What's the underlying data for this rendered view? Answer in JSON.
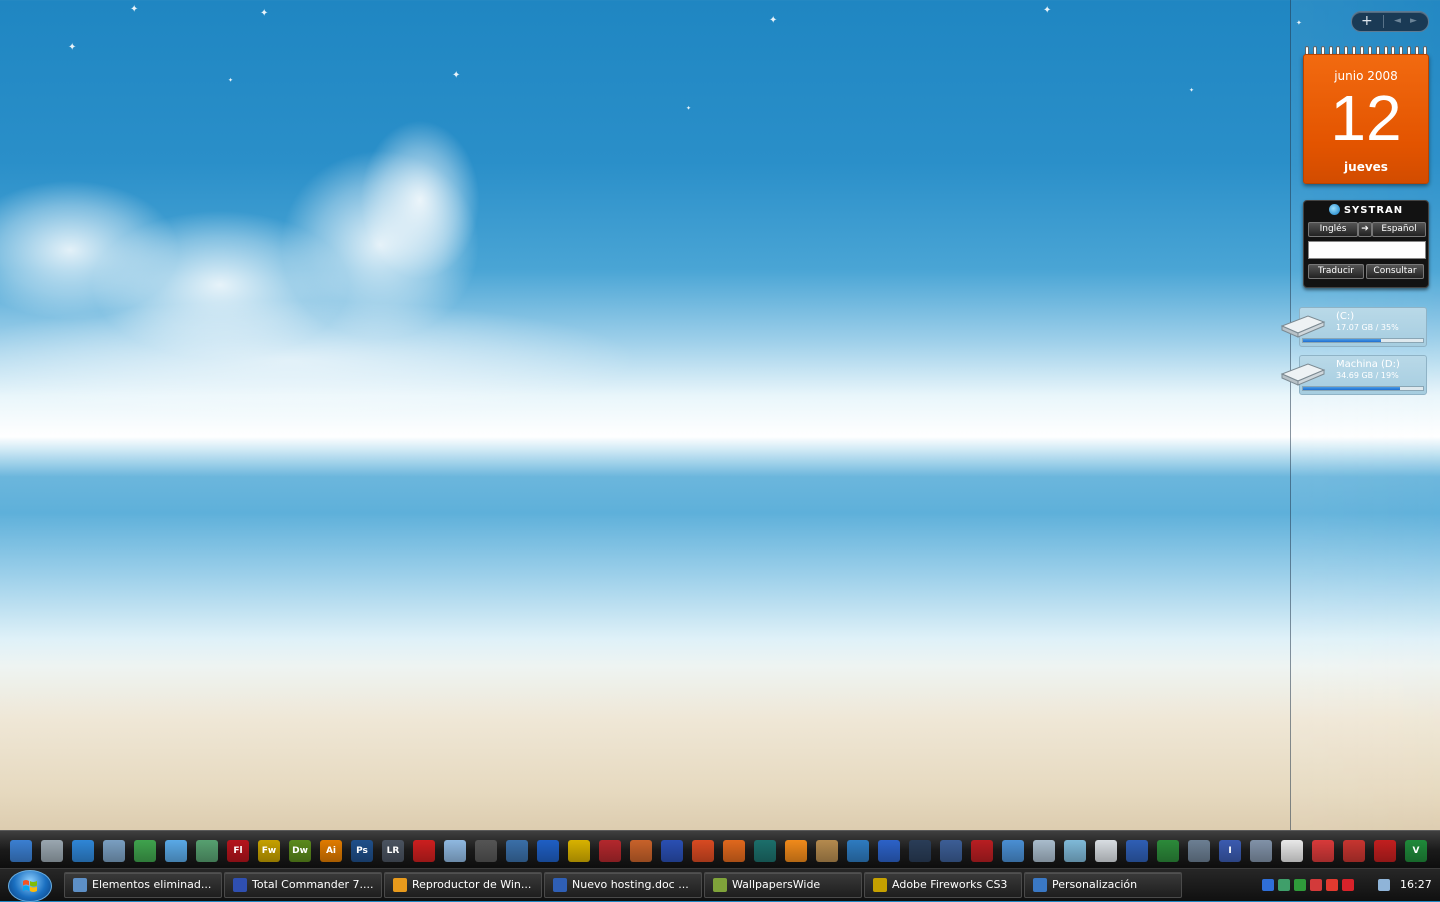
{
  "sidebar": {
    "controls": {
      "add_glyph": "+",
      "prev_glyph": "◄",
      "next_glyph": "►"
    },
    "calendar": {
      "month_year": "junio 2008",
      "day": "12",
      "weekday": "jueves"
    },
    "systran": {
      "brand": "SYSTRAN",
      "from_language": "Inglés",
      "swap_glyph": "➔",
      "to_language": "Español",
      "input_value": "",
      "translate_label": "Traducir",
      "lookup_label": "Consultar"
    },
    "drives": [
      {
        "name": "(C:)",
        "info": "17.07 GB / 35%",
        "used_fraction": 0.65
      },
      {
        "name": "Machina (D:)",
        "info": "34.69 GB / 19%",
        "used_fraction": 0.81
      }
    ]
  },
  "dock": {
    "apps": [
      {
        "icon": "show-desktop-icon",
        "label": "",
        "color": "#3b7fd1"
      },
      {
        "icon": "computer-icon",
        "label": "",
        "color": "#9aa7b0"
      },
      {
        "icon": "internet-explorer-icon",
        "label": "",
        "color": "#2f86d6"
      },
      {
        "icon": "folder-icon",
        "label": "",
        "color": "#7a9fc1"
      },
      {
        "icon": "utility-icon",
        "label": "",
        "color": "#3fa34d"
      },
      {
        "icon": "messenger-icon",
        "label": "",
        "color": "#5aa9e6"
      },
      {
        "icon": "network-icon",
        "label": "",
        "color": "#57a070"
      },
      {
        "icon": "flash-icon",
        "label": "Fl",
        "color": "#b5141c"
      },
      {
        "icon": "fireworks-icon",
        "label": "Fw",
        "color": "#c5a000"
      },
      {
        "icon": "dreamweaver-icon",
        "label": "Dw",
        "color": "#5b8a1c"
      },
      {
        "icon": "illustrator-icon",
        "label": "Ai",
        "color": "#e07b00"
      },
      {
        "icon": "photoshop-icon",
        "label": "Ps",
        "color": "#1f4f8a"
      },
      {
        "icon": "lightroom-icon",
        "label": "LR",
        "color": "#4a5360"
      },
      {
        "icon": "media-app-icon",
        "label": "",
        "color": "#cc1f1f"
      },
      {
        "icon": "itunes-icon",
        "label": "",
        "color": "#8fb8e0"
      },
      {
        "icon": "phone-icon",
        "label": "",
        "color": "#555555"
      },
      {
        "icon": "xbox-media-icon",
        "label": "",
        "color": "#3a6fa8"
      },
      {
        "icon": "media-player-icon",
        "label": "",
        "color": "#1f5fc4"
      },
      {
        "icon": "winamp-icon",
        "label": "",
        "color": "#d8b200"
      },
      {
        "icon": "film-icon",
        "label": "",
        "color": "#b3282d"
      },
      {
        "icon": "archive-icon",
        "label": "",
        "color": "#c8622a"
      },
      {
        "icon": "save-icon",
        "label": "",
        "color": "#2a4fb3"
      },
      {
        "icon": "checkmark-icon",
        "label": "",
        "color": "#d84a22"
      },
      {
        "icon": "firefox-icon",
        "label": "",
        "color": "#e0681d"
      },
      {
        "icon": "netscape-icon",
        "label": "",
        "color": "#1c6f6b"
      },
      {
        "icon": "vlc-icon",
        "label": "",
        "color": "#f08a1b"
      },
      {
        "icon": "tool-icon",
        "label": "",
        "color": "#b48a4e"
      },
      {
        "icon": "arch-icon",
        "label": "",
        "color": "#2e7bc0"
      },
      {
        "icon": "plane-icon",
        "label": "",
        "color": "#2c62c8"
      },
      {
        "icon": "webcam-icon",
        "label": "",
        "color": "#2a3d58"
      },
      {
        "icon": "editor-icon",
        "label": "",
        "color": "#3c5e96"
      },
      {
        "icon": "acrobat-icon",
        "label": "",
        "color": "#b81e22"
      },
      {
        "icon": "refresh-app-icon",
        "label": "",
        "color": "#4a8fd3"
      },
      {
        "icon": "notepad-icon",
        "label": "",
        "color": "#a9bccc"
      },
      {
        "icon": "glass-app-icon",
        "label": "",
        "color": "#7fb9d8"
      },
      {
        "icon": "envelope-icon",
        "label": "",
        "color": "#d8dde2"
      },
      {
        "icon": "word-icon",
        "label": "",
        "color": "#2f5fb5"
      },
      {
        "icon": "excel-icon",
        "label": "",
        "color": "#2c8a3a"
      },
      {
        "icon": "camera-icon",
        "label": "",
        "color": "#6c7f93"
      },
      {
        "icon": "text-tool-icon",
        "label": "I",
        "color": "#3b5bb0"
      },
      {
        "icon": "pen-icon",
        "label": "",
        "color": "#8192a8"
      },
      {
        "icon": "mask-icon",
        "label": "",
        "color": "#e8e8e8"
      },
      {
        "icon": "balloon-icon",
        "label": "",
        "color": "#d83a3a"
      },
      {
        "icon": "cube-icon",
        "label": "",
        "color": "#c73530"
      },
      {
        "icon": "opera-icon",
        "label": "",
        "color": "#c21f1f"
      },
      {
        "icon": "vim-icon",
        "label": "V",
        "color": "#1f8a3a"
      }
    ]
  },
  "taskbar": {
    "tasks": [
      {
        "icon": "recycle-bin-icon",
        "label": "Elementos eliminad...",
        "color": "#5d8fc6"
      },
      {
        "icon": "total-commander-icon",
        "label": "Total Commander 7....",
        "color": "#2f4fb0"
      },
      {
        "icon": "media-player-icon",
        "label": "Reproductor de Win...",
        "color": "#e89a1c"
      },
      {
        "icon": "word-icon",
        "label": "Nuevo hosting.doc ...",
        "color": "#2f5fb5"
      },
      {
        "icon": "folder-icon",
        "label": "WallpapersWide",
        "color": "#7fa33a"
      },
      {
        "icon": "fireworks-icon",
        "label": "Adobe Fireworks CS3",
        "color": "#c5a000"
      },
      {
        "icon": "personalization-icon",
        "label": "Personalización",
        "color": "#3a78c4"
      }
    ],
    "tray": {
      "icons": [
        {
          "icon": "bluetooth-icon",
          "color": "#2f6fd8"
        },
        {
          "icon": "network-icon",
          "color": "#3f9f6a"
        },
        {
          "icon": "security-icon",
          "color": "#2f9a3a"
        },
        {
          "icon": "chat-icon",
          "color": "#d33a3a"
        },
        {
          "icon": "arrow-app-icon",
          "color": "#e23a2f"
        },
        {
          "icon": "m-app-icon",
          "color": "#d8222a"
        },
        {
          "icon": "volume-icon",
          "color": "#8fb4d8"
        }
      ],
      "clock": "16:27"
    }
  }
}
